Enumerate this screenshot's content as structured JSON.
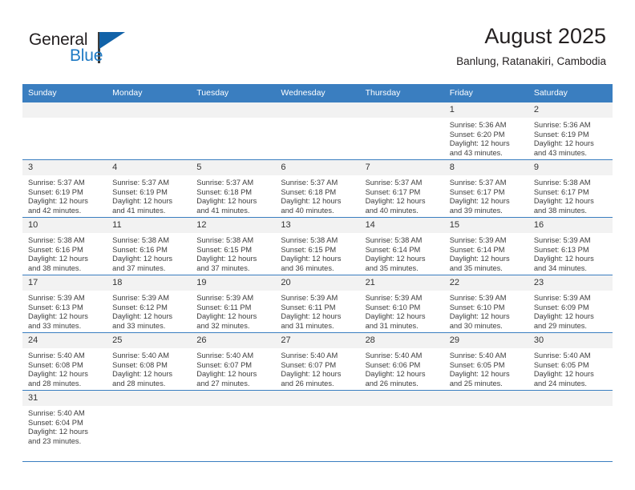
{
  "brand": {
    "name_part1": "General",
    "name_part2": "Blue",
    "logo_icon": "triangle-flag-logo"
  },
  "header": {
    "title": "August 2025",
    "subtitle": "Banlung, Ratanakiri, Cambodia"
  },
  "calendar": {
    "weekday_headers": [
      "Sunday",
      "Monday",
      "Tuesday",
      "Wednesday",
      "Thursday",
      "Friday",
      "Saturday"
    ],
    "accent_color": "#3a7ec0",
    "daynum_bg": "#f2f2f2",
    "weeks": [
      [
        {
          "day": "",
          "lines": []
        },
        {
          "day": "",
          "lines": []
        },
        {
          "day": "",
          "lines": []
        },
        {
          "day": "",
          "lines": []
        },
        {
          "day": "",
          "lines": []
        },
        {
          "day": "1",
          "lines": [
            "Sunrise: 5:36 AM",
            "Sunset: 6:20 PM",
            "Daylight: 12 hours",
            "and 43 minutes."
          ]
        },
        {
          "day": "2",
          "lines": [
            "Sunrise: 5:36 AM",
            "Sunset: 6:19 PM",
            "Daylight: 12 hours",
            "and 43 minutes."
          ]
        }
      ],
      [
        {
          "day": "3",
          "lines": [
            "Sunrise: 5:37 AM",
            "Sunset: 6:19 PM",
            "Daylight: 12 hours",
            "and 42 minutes."
          ]
        },
        {
          "day": "4",
          "lines": [
            "Sunrise: 5:37 AM",
            "Sunset: 6:19 PM",
            "Daylight: 12 hours",
            "and 41 minutes."
          ]
        },
        {
          "day": "5",
          "lines": [
            "Sunrise: 5:37 AM",
            "Sunset: 6:18 PM",
            "Daylight: 12 hours",
            "and 41 minutes."
          ]
        },
        {
          "day": "6",
          "lines": [
            "Sunrise: 5:37 AM",
            "Sunset: 6:18 PM",
            "Daylight: 12 hours",
            "and 40 minutes."
          ]
        },
        {
          "day": "7",
          "lines": [
            "Sunrise: 5:37 AM",
            "Sunset: 6:17 PM",
            "Daylight: 12 hours",
            "and 40 minutes."
          ]
        },
        {
          "day": "8",
          "lines": [
            "Sunrise: 5:37 AM",
            "Sunset: 6:17 PM",
            "Daylight: 12 hours",
            "and 39 minutes."
          ]
        },
        {
          "day": "9",
          "lines": [
            "Sunrise: 5:38 AM",
            "Sunset: 6:17 PM",
            "Daylight: 12 hours",
            "and 38 minutes."
          ]
        }
      ],
      [
        {
          "day": "10",
          "lines": [
            "Sunrise: 5:38 AM",
            "Sunset: 6:16 PM",
            "Daylight: 12 hours",
            "and 38 minutes."
          ]
        },
        {
          "day": "11",
          "lines": [
            "Sunrise: 5:38 AM",
            "Sunset: 6:16 PM",
            "Daylight: 12 hours",
            "and 37 minutes."
          ]
        },
        {
          "day": "12",
          "lines": [
            "Sunrise: 5:38 AM",
            "Sunset: 6:15 PM",
            "Daylight: 12 hours",
            "and 37 minutes."
          ]
        },
        {
          "day": "13",
          "lines": [
            "Sunrise: 5:38 AM",
            "Sunset: 6:15 PM",
            "Daylight: 12 hours",
            "and 36 minutes."
          ]
        },
        {
          "day": "14",
          "lines": [
            "Sunrise: 5:38 AM",
            "Sunset: 6:14 PM",
            "Daylight: 12 hours",
            "and 35 minutes."
          ]
        },
        {
          "day": "15",
          "lines": [
            "Sunrise: 5:39 AM",
            "Sunset: 6:14 PM",
            "Daylight: 12 hours",
            "and 35 minutes."
          ]
        },
        {
          "day": "16",
          "lines": [
            "Sunrise: 5:39 AM",
            "Sunset: 6:13 PM",
            "Daylight: 12 hours",
            "and 34 minutes."
          ]
        }
      ],
      [
        {
          "day": "17",
          "lines": [
            "Sunrise: 5:39 AM",
            "Sunset: 6:13 PM",
            "Daylight: 12 hours",
            "and 33 minutes."
          ]
        },
        {
          "day": "18",
          "lines": [
            "Sunrise: 5:39 AM",
            "Sunset: 6:12 PM",
            "Daylight: 12 hours",
            "and 33 minutes."
          ]
        },
        {
          "day": "19",
          "lines": [
            "Sunrise: 5:39 AM",
            "Sunset: 6:11 PM",
            "Daylight: 12 hours",
            "and 32 minutes."
          ]
        },
        {
          "day": "20",
          "lines": [
            "Sunrise: 5:39 AM",
            "Sunset: 6:11 PM",
            "Daylight: 12 hours",
            "and 31 minutes."
          ]
        },
        {
          "day": "21",
          "lines": [
            "Sunrise: 5:39 AM",
            "Sunset: 6:10 PM",
            "Daylight: 12 hours",
            "and 31 minutes."
          ]
        },
        {
          "day": "22",
          "lines": [
            "Sunrise: 5:39 AM",
            "Sunset: 6:10 PM",
            "Daylight: 12 hours",
            "and 30 minutes."
          ]
        },
        {
          "day": "23",
          "lines": [
            "Sunrise: 5:39 AM",
            "Sunset: 6:09 PM",
            "Daylight: 12 hours",
            "and 29 minutes."
          ]
        }
      ],
      [
        {
          "day": "24",
          "lines": [
            "Sunrise: 5:40 AM",
            "Sunset: 6:08 PM",
            "Daylight: 12 hours",
            "and 28 minutes."
          ]
        },
        {
          "day": "25",
          "lines": [
            "Sunrise: 5:40 AM",
            "Sunset: 6:08 PM",
            "Daylight: 12 hours",
            "and 28 minutes."
          ]
        },
        {
          "day": "26",
          "lines": [
            "Sunrise: 5:40 AM",
            "Sunset: 6:07 PM",
            "Daylight: 12 hours",
            "and 27 minutes."
          ]
        },
        {
          "day": "27",
          "lines": [
            "Sunrise: 5:40 AM",
            "Sunset: 6:07 PM",
            "Daylight: 12 hours",
            "and 26 minutes."
          ]
        },
        {
          "day": "28",
          "lines": [
            "Sunrise: 5:40 AM",
            "Sunset: 6:06 PM",
            "Daylight: 12 hours",
            "and 26 minutes."
          ]
        },
        {
          "day": "29",
          "lines": [
            "Sunrise: 5:40 AM",
            "Sunset: 6:05 PM",
            "Daylight: 12 hours",
            "and 25 minutes."
          ]
        },
        {
          "day": "30",
          "lines": [
            "Sunrise: 5:40 AM",
            "Sunset: 6:05 PM",
            "Daylight: 12 hours",
            "and 24 minutes."
          ]
        }
      ],
      [
        {
          "day": "31",
          "lines": [
            "Sunrise: 5:40 AM",
            "Sunset: 6:04 PM",
            "Daylight: 12 hours",
            "and 23 minutes."
          ]
        },
        {
          "day": "",
          "lines": []
        },
        {
          "day": "",
          "lines": []
        },
        {
          "day": "",
          "lines": []
        },
        {
          "day": "",
          "lines": []
        },
        {
          "day": "",
          "lines": []
        },
        {
          "day": "",
          "lines": []
        }
      ]
    ]
  }
}
